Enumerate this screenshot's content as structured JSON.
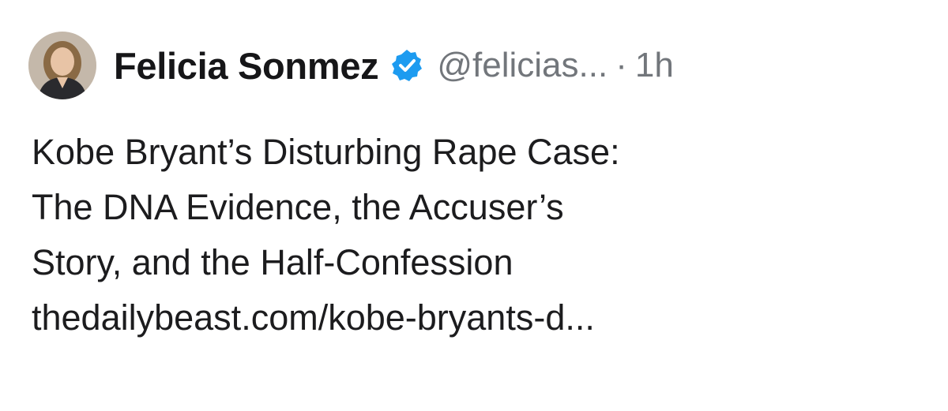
{
  "tweet": {
    "author": {
      "display_name": "Felicia Sonmez",
      "handle": "@felicias...",
      "verified_icon": "verified-badge-icon",
      "avatar_icon": "avatar-photo"
    },
    "separator": "·",
    "time": "1h",
    "text_lines": [
      "Kobe Bryant’s Disturbing Rape Case:",
      "The DNA Evidence, the Accuser’s",
      "Story, and the Half-Confession"
    ],
    "link": "thedailybeast.com/kobe-bryants-d...",
    "colors": {
      "verified_blue": "#1d9bf0",
      "meta_gray": "#72767b",
      "text": "#1c1c1e"
    }
  }
}
